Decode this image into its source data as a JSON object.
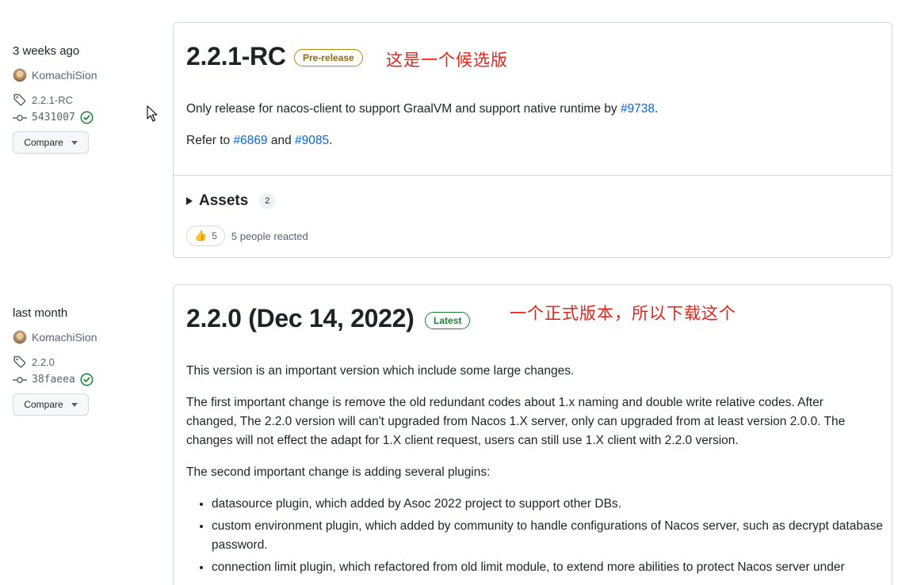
{
  "releases": [
    {
      "date": "3 weeks ago",
      "author": "KomachiSion",
      "tag": "2.2.1-RC",
      "commit": "5431007",
      "compare_label": "Compare",
      "title": "2.2.1-RC",
      "badge": "Pre-release",
      "annotation": "这是一个候选版",
      "paragraphs": {
        "p1_before": "Only release for nacos-client to support GraalVM and support native runtime by ",
        "p1_link": "#9738",
        "p1_after": ".",
        "p2_before": "Refer to ",
        "p2_link1": "#6869",
        "p2_mid": " and ",
        "p2_link2": "#9085",
        "p2_after": "."
      },
      "assets_label": "Assets",
      "assets_count": "2",
      "reaction_count": "5",
      "reaction_text": "5 people reacted"
    },
    {
      "date": "last month",
      "author": "KomachiSion",
      "tag": "2.2.0",
      "commit": "38faeea",
      "compare_label": "Compare",
      "title": "2.2.0 (Dec 14, 2022)",
      "badge": "Latest",
      "annotation": "一个正式版本，所以下载这个",
      "paragraphs": {
        "p1": "This version is an important version which include some large changes.",
        "p2": "The first important change is remove the old redundant codes about 1.x naming and double write relative codes. After changed, The 2.2.0 version will can't upgraded from Nacos 1.X server, only can upgraded from at least version 2.0.0. The changes will not effect the adapt for 1.X client request, users can still use 1.X client with 2.2.0 version.",
        "p3": "The second important change is adding several plugins:"
      },
      "bullets": [
        "datasource plugin, which added by Asoc 2022 project to support other DBs.",
        "custom environment plugin, which added by community to handle configurations of Nacos server, such as decrypt database password.",
        "connection limit plugin, which refactored from old limit module, to extend more abilities to protect Nacos server under"
      ]
    }
  ],
  "icons": {
    "tag": "tag-icon",
    "commit": "git-commit-icon",
    "verified": "verified-check-icon",
    "caret": "triangle-down-icon",
    "disclosure": "triangle-right-icon",
    "thumbsup": "thumbs-up-emoji",
    "cursor": "mouse-pointer-icon"
  },
  "colors": {
    "link": "#0969da",
    "prerelease": "#9a6700",
    "latest": "#1a7f37",
    "annotation": "#e0251b"
  }
}
